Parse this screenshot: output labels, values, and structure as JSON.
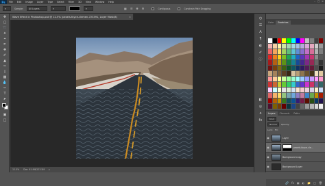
{
  "app": {
    "logo": "Ps"
  },
  "menu": [
    "File",
    "Edit",
    "Image",
    "Layer",
    "Type",
    "Select",
    "Filter",
    "3D",
    "View",
    "Window",
    "Help"
  ],
  "window_controls": [
    "–",
    "□",
    "✕"
  ],
  "options_bar": {
    "sample_label": "Sample:",
    "sample_value": "All Layers",
    "contiguous_label": "Contiguous",
    "path_drag_label": "Constrain Path Dragging"
  },
  "document": {
    "tab_title": "Wave Effect in Photoshop.psd @ 12.5% (pexels-foyce-clemen-723391, Layer Mask/8)",
    "close": "×"
  },
  "status_bar": {
    "zoom": "12.5%",
    "doc_size": "Doc: 61.9M/123.5M"
  },
  "panels": {
    "top_tabs": [
      "Color",
      "Swatches"
    ],
    "bottom_tabs": [
      "Layers",
      "Channels",
      "Paths"
    ],
    "kind_label": "Kind",
    "blend_mode": "Normal",
    "opacity_label": "Opacity:",
    "lock_label": "Lock:",
    "fill_label": "Fill:"
  },
  "layers": [
    {
      "name": "Layer",
      "selected": false
    },
    {
      "name": "pexels-foyce-cle...",
      "selected": true
    },
    {
      "name": "Background copy",
      "selected": false
    },
    {
      "name": "Background Layer",
      "selected": false
    }
  ],
  "swatch_colors": [
    "#ffffff",
    "#000000",
    "#ff0000",
    "#ffff00",
    "#00ff00",
    "#00ffff",
    "#0000ff",
    "#ff00ff",
    "#c0c0c0",
    "#808080",
    "#404040",
    "#800000",
    "#f2b2b2",
    "#f7d1a5",
    "#fff2a8",
    "#cfe6a3",
    "#a3d7b0",
    "#a3d9e0",
    "#a5c0e6",
    "#b7a8dc",
    "#d9a8d8",
    "#e6a8bf",
    "#cccccc",
    "#999999",
    "#ee6666",
    "#f4a55e",
    "#ffe066",
    "#a6d35f",
    "#5fbf7a",
    "#5fc5d3",
    "#5f8fd6",
    "#8a6fcf",
    "#c36fc7",
    "#d86f99",
    "#b3b3b3",
    "#7f7f7f",
    "#e02424",
    "#ef7f1a",
    "#ffd11a",
    "#7cc21e",
    "#1ea653",
    "#1eaec2",
    "#1e63c8",
    "#5a35bd",
    "#a535b3",
    "#c8356f",
    "#8c8c8c",
    "#595959",
    "#a81b1b",
    "#b65f13",
    "#c29f13",
    "#5e9216",
    "#167d3f",
    "#168393",
    "#164b97",
    "#44288f",
    "#7d2887",
    "#972854",
    "#666666",
    "#333333",
    "#701212",
    "#7a400d",
    "#826a0d",
    "#3f620f",
    "#0f542a",
    "#0f5862",
    "#0f3265",
    "#2d1b60",
    "#541b5a",
    "#651b38",
    "#4d4d4d",
    "#1a1a1a",
    "#c9a77c",
    "#a3825a",
    "#7d5f3b",
    "#5a3f24",
    "#3a2714",
    "#d8c4a0",
    "#b89f75",
    "#8e764d",
    "#67522e",
    "#433318",
    "#f0e0c0",
    "#e0c8a0",
    "#ff9999",
    "#ffcc99",
    "#ffff99",
    "#ccff99",
    "#99ff99",
    "#99ffcc",
    "#99ffff",
    "#99ccff",
    "#9999ff",
    "#cc99ff",
    "#ff99ff",
    "#ff99cc",
    "#cc3333",
    "#cc6633",
    "#cccc33",
    "#66cc33",
    "#33cc66",
    "#33cccc",
    "#3366cc",
    "#6633cc",
    "#cc33cc",
    "#cc3366",
    "#666699",
    "#336666",
    "#ffccff",
    "#ccffff",
    "#ffffcc",
    "#e6e6e6",
    "#d9ead3",
    "#cfe2f3",
    "#fce5cd",
    "#f4cccc",
    "#ead1dc",
    "#d9d2e9",
    "#fff2cc",
    "#c9daf8",
    "#e06666",
    "#f6b26b",
    "#ffd966",
    "#93c47d",
    "#76a5af",
    "#6fa8dc",
    "#8e7cc3",
    "#c27ba0",
    "#3d85c6",
    "#6aa84f",
    "#bf9000",
    "#a61c00",
    "#990000",
    "#b45f06",
    "#bf9000",
    "#38761d",
    "#134f5c",
    "#0b5394",
    "#351c75",
    "#741b47",
    "#5b0f00",
    "#274e13",
    "#073763",
    "#20124d",
    "#4c1130",
    "#7f6000",
    "#783f04",
    "#660000",
    "#0c343d",
    "#1c4587",
    "#434343",
    "#666666",
    "#999999",
    "#b7b7b7",
    "#d9d9d9",
    "#efefef"
  ]
}
